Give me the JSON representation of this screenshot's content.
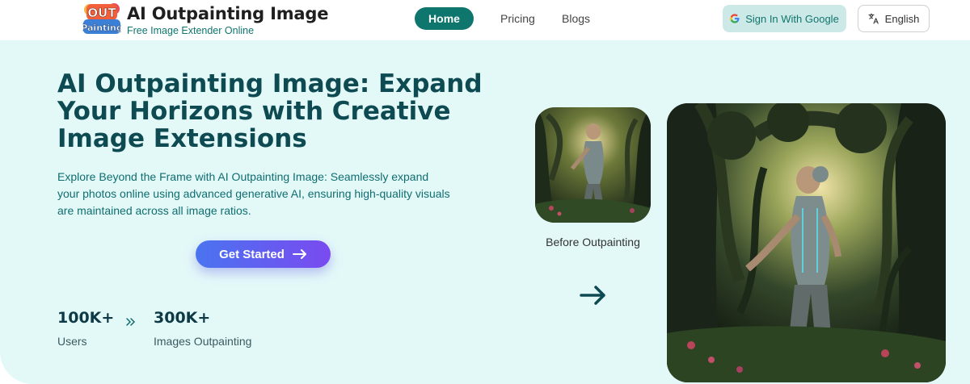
{
  "header": {
    "logo_top": "OUT",
    "logo_bottom": "Painting",
    "brand_title": "AI Outpainting Image",
    "brand_subtitle": "Free Image Extender Online",
    "nav": {
      "home": "Home",
      "pricing": "Pricing",
      "blogs": "Blogs"
    },
    "signin_label": "Sign In With Google",
    "language_label": "English"
  },
  "hero": {
    "title": "AI Outpainting Image: Expand Your Horizons with Creative Image Extensions",
    "description": "Explore Beyond the Frame with AI Outpainting Image: Seamlessly expand your photos online using advanced generative AI, ensuring high-quality visuals are maintained across all image ratios.",
    "cta_label": "Get Started",
    "stats": [
      {
        "value": "100K+",
        "label": "Users"
      },
      {
        "value": "300K+",
        "label": "Images Outpainting"
      }
    ],
    "before_caption": "Before Outpainting"
  },
  "colors": {
    "accent": "#0f766e",
    "hero_bg": "#e3f9f8",
    "heading": "#0e4a52",
    "cta_gradient_start": "#4a74f0",
    "cta_gradient_end": "#7a4af0"
  },
  "icons": {
    "google": "google-g-icon",
    "language": "translate-icon",
    "cta_arrow": "arrow-right-icon",
    "stats_separator": "double-chevron-right-icon",
    "comparison_arrow": "arrow-right-icon"
  }
}
